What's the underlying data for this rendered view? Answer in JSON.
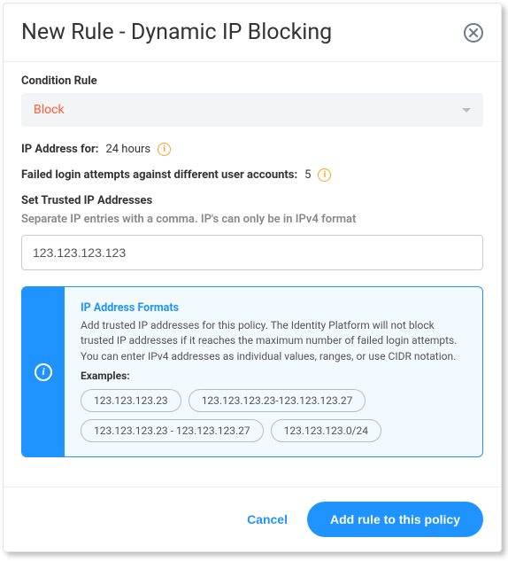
{
  "header": {
    "title": "New Rule - Dynamic IP Blocking"
  },
  "condition": {
    "label": "Condition Rule",
    "value": "Block"
  },
  "ip_block_for": {
    "label": "IP Address for:",
    "value": "24 hours"
  },
  "failed_attempts": {
    "label": "Failed login attempts against different user accounts:",
    "value": "5"
  },
  "trusted": {
    "label": "Set Trusted IP Addresses",
    "hint": "Separate IP entries with a comma. IP's can only be in IPv4 format",
    "input_value": "123.123.123.123"
  },
  "info": {
    "title": "IP Address Formats",
    "desc": "Add trusted IP addresses for this policy. The Identity Platform will not block trusted IP addresses if it reaches the maximum number of failed login attempts. You can enter IPv4 addresses as individual values, ranges, or use CIDR notation.",
    "examples_label": "Examples:",
    "examples": [
      "123.123.123.23",
      "123.123.123.23-123.123.123.27",
      "123.123.123.23 - 123.123.123.27",
      "123.123.123.0/24"
    ]
  },
  "footer": {
    "cancel": "Cancel",
    "submit": "Add rule to this policy"
  }
}
